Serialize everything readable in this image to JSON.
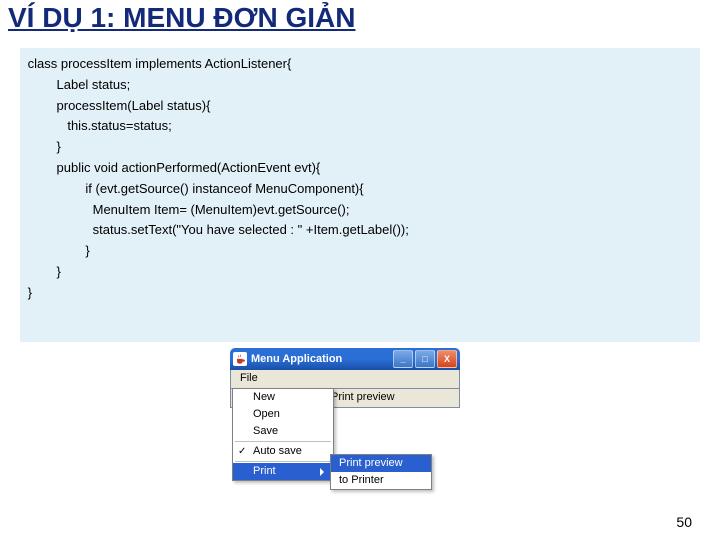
{
  "title": "VÍ DỤ 1: MENU ĐƠN GIẢN",
  "code": " class processItem implements ActionListener{\n         Label status;\n         processItem(Label status){\n            this.status=status;\n         }\n         public void actionPerformed(ActionEvent evt){\n                 if (evt.getSource() instanceof MenuComponent){\n                   MenuItem Item= (MenuItem)evt.getSource();\n                   status.setText(\"You have selected : \" +Item.getLabel());\n                 }\n         }\n }",
  "app": {
    "title": "Menu Application",
    "menubar": {
      "file": "File"
    },
    "client_text": "Print preview",
    "file_menu": {
      "new": "New",
      "open": "Open",
      "save": "Save",
      "autosave": "Auto save",
      "print": "Print"
    },
    "print_submenu": {
      "preview": "Print preview",
      "printer": "to Printer"
    }
  },
  "page_number": "50"
}
